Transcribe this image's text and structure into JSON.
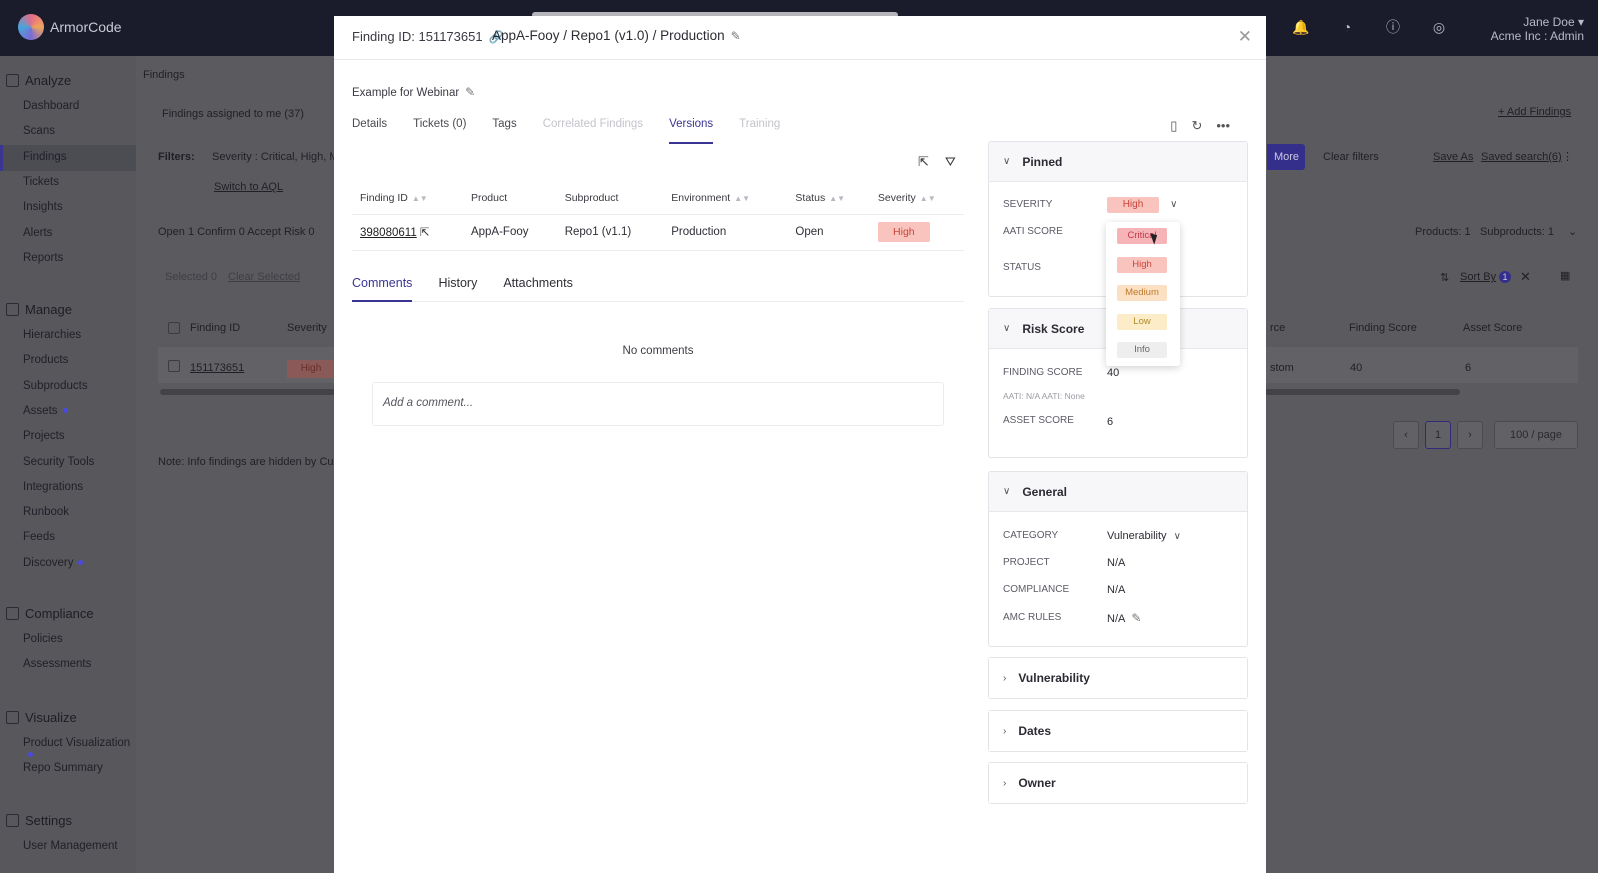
{
  "app": {
    "logo_text": "ArmorCode",
    "user_name": "Jane Doe ▾",
    "user_org": "Acme Inc : Admin"
  },
  "sidebar": {
    "groups": [
      {
        "label": "Analyze",
        "icon": "chart-icon",
        "items": [
          "Dashboard",
          "Scans",
          "Findings",
          "Tickets",
          "Insights",
          "Alerts",
          "Reports"
        ]
      },
      {
        "label": "Manage",
        "icon": "briefcase-icon",
        "items": [
          "Hierarchies",
          "Products",
          "Subproducts",
          "Assets",
          "Projects",
          "Security Tools",
          "Integrations",
          "Runbook",
          "Feeds",
          "Discovery"
        ]
      },
      {
        "label": "Compliance",
        "icon": "clipboard-icon",
        "items": [
          "Policies",
          "Assessments"
        ]
      },
      {
        "label": "Visualize",
        "icon": "visualize-icon",
        "items": [
          "Product Visualization",
          "Repo Summary"
        ]
      },
      {
        "label": "Settings",
        "icon": "gear-icon",
        "items": [
          "User Management"
        ]
      }
    ],
    "active_item": "Findings"
  },
  "background": {
    "breadcrumb": "Findings",
    "assigned": "Findings assigned to me (37)",
    "filters_label": "Filters:",
    "filter_value": "Severity : Critical, High, M",
    "switch_aql": "Switch to AQL",
    "counts": "Open 1   Confirm 0   Accept Risk 0",
    "selected": "Selected 0",
    "clear_selected": "Clear Selected",
    "col_finding_id": "Finding ID",
    "col_severity": "Severity",
    "row_id": "151173651",
    "row_severity": "High",
    "note": "Note: Info findings are hidden by Cu",
    "add_findings": "+ Add Findings",
    "more": "More",
    "clear_filters": "Clear filters",
    "save_as": "Save As",
    "saved_search": "Saved search(6)",
    "products_count": "Products: 1",
    "subproducts_count": "Subproducts: 1",
    "sort_by": "Sort By",
    "sort_badge": "1",
    "col_source": "rce",
    "col_finding_score": "Finding Score",
    "col_asset_score": "Asset Score",
    "row_source": "stom",
    "row_finding_score": "40",
    "row_asset_score": "6",
    "page": "1",
    "per_page": "100 / page"
  },
  "modal": {
    "finding_label": "Finding ID: 151173651",
    "breadcrumb": "AppA-Fooy  /  Repo1 (v1.0)  /  Production",
    "description": "Example for Webinar",
    "tabs": [
      {
        "label": "Details",
        "state": "normal"
      },
      {
        "label": "Tickets (0)",
        "state": "normal"
      },
      {
        "label": "Tags",
        "state": "normal"
      },
      {
        "label": "Correlated Findings",
        "state": "disabled"
      },
      {
        "label": "Versions",
        "state": "active"
      },
      {
        "label": "Training",
        "state": "disabled"
      }
    ],
    "table": {
      "headers": [
        "Finding ID",
        "Product",
        "Subproduct",
        "Environment",
        "Status",
        "Severity"
      ],
      "rows": [
        {
          "finding_id": "398080611",
          "product": "AppA-Fooy",
          "subproduct": "Repo1 (v1.1)",
          "environment": "Production",
          "status": "Open",
          "severity": "High"
        }
      ]
    },
    "subtabs": [
      "Comments",
      "History",
      "Attachments"
    ],
    "no_comments": "No comments",
    "comment_placeholder": "Add a comment..."
  },
  "panels": {
    "pinned": {
      "title": "Pinned",
      "severity_label": "SEVERITY",
      "severity_value": "High",
      "aati_label": "AATI SCORE",
      "status_label": "STATUS"
    },
    "severity_options": [
      {
        "label": "Critical",
        "bg": "#f6b3b8",
        "fg": "#c23a4a"
      },
      {
        "label": "High",
        "bg": "#f8c4bd",
        "fg": "#c9453a"
      },
      {
        "label": "Medium",
        "bg": "#fbe0c4",
        "fg": "#c07a2a"
      },
      {
        "label": "Low",
        "bg": "#fcecc8",
        "fg": "#b08a2a"
      },
      {
        "label": "Info",
        "bg": "#eeeeee",
        "fg": "#666666"
      }
    ],
    "risk": {
      "title": "Risk Score",
      "finding_score_label": "FINDING SCORE",
      "finding_score": "40",
      "aati_note": "AATI: N/A    AATI: None",
      "asset_score_label": "ASSET SCORE",
      "asset_score": "6"
    },
    "general": {
      "title": "General",
      "category_label": "CATEGORY",
      "category": "Vulnerability",
      "project_label": "PROJECT",
      "project": "N/A",
      "compliance_label": "COMPLIANCE",
      "compliance": "N/A",
      "amc_label": "AMC RULES",
      "amc": "N/A"
    },
    "vulnerability": {
      "title": "Vulnerability"
    },
    "dates": {
      "title": "Dates"
    },
    "owner": {
      "title": "Owner"
    }
  }
}
